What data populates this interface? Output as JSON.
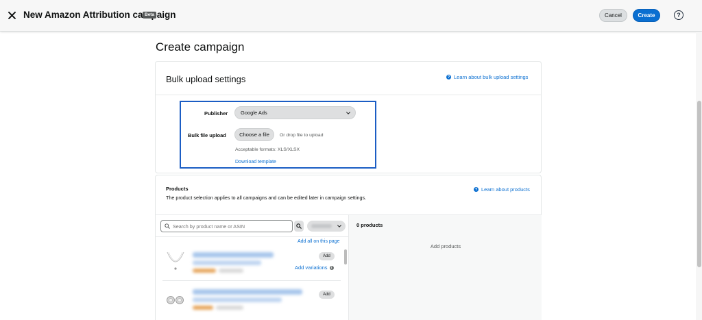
{
  "header": {
    "title": "New Amazon Attribution campaign",
    "badge": "Beta",
    "cancel_label": "Cancel",
    "create_label": "Create",
    "help_label": "?",
    "close_icon": "close-icon"
  },
  "page": {
    "title": "Create campaign"
  },
  "bulk_upload": {
    "title": "Bulk upload settings",
    "learn_link": "Learn about bulk upload settings",
    "publisher_label": "Publisher",
    "publisher_value": "Google Ads",
    "bulk_file_label": "Bulk file upload",
    "choose_file_label": "Choose a file",
    "drop_text": "Or drop file to upload",
    "formats_text": "Acceptable formats: XLS/XLSX",
    "download_template": "Download template"
  },
  "products": {
    "title": "Products",
    "description": "The product selection applies to all campaigns and can be edited later in campaign settings.",
    "learn_link": "Learn about products",
    "search_placeholder": "Search by product name or ASIN",
    "add_all": "Add all on this page",
    "selected_count": "0 products",
    "add_products": "Add products",
    "items": [
      {
        "add_label": "Add",
        "variations_label": "Add variations"
      },
      {
        "add_label": "Add"
      }
    ]
  },
  "colors": {
    "accent": "#0a6fd1",
    "highlight_border": "#1b5dc4"
  }
}
